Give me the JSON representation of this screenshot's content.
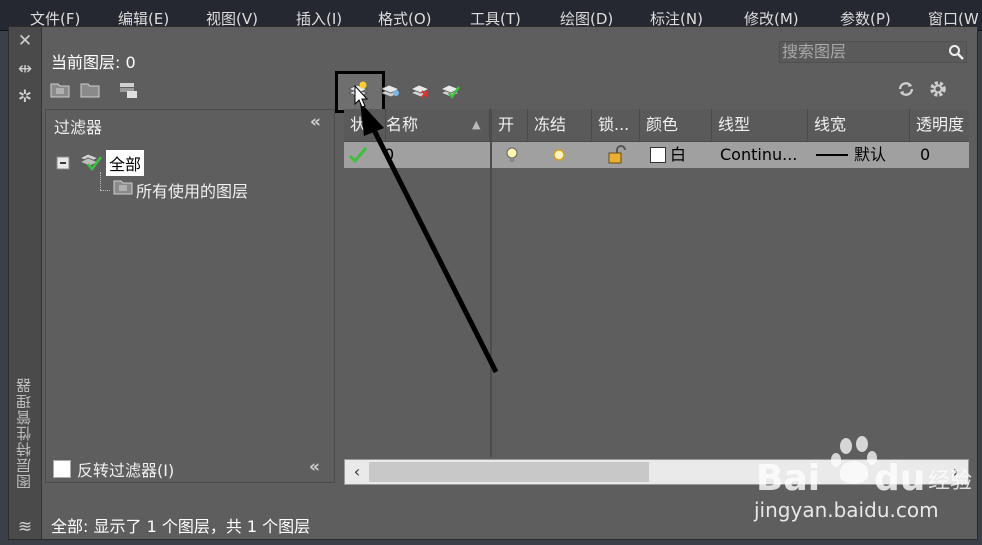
{
  "menubar": {
    "items": [
      "文件(F)",
      "编辑(E)",
      "视图(V)",
      "插入(I)",
      "格式(O)",
      "工具(T)",
      "绘图(D)",
      "标注(N)",
      "修改(M)",
      "参数(P)",
      "窗口(W"
    ]
  },
  "palette": {
    "vertical_title": "图层特性管理器",
    "current_layer": "当前图层: 0",
    "search_placeholder": "搜索图层",
    "status": "全部: 显示了 1 个图层，共 1 个图层"
  },
  "filters": {
    "header": "过滤器",
    "tree": [
      {
        "label": "全部",
        "selected": true
      },
      {
        "label": "所有使用的图层",
        "selected": false
      }
    ],
    "invert_label": "反转过滤器(I)"
  },
  "layer_table": {
    "columns": [
      "状",
      "名称",
      "开",
      "冻结",
      "锁...",
      "颜色",
      "线型",
      "线宽",
      "透明度"
    ],
    "rows": [
      {
        "status": "current",
        "name": "0",
        "on": true,
        "frozen": false,
        "locked": false,
        "color_name": "白",
        "color_hex": "#ffffff",
        "linetype": "Continu...",
        "lineweight": "默认",
        "transparency": "0"
      }
    ]
  },
  "colors": {
    "panel_bg": "#5e5e5e",
    "row_selected_bg": "#a0a0a0",
    "accent_check": "#3fbf3f",
    "delete_red": "#e03030"
  },
  "watermark": {
    "logo_text": "Bai du 经验",
    "url": "jingyan.baidu.com"
  }
}
